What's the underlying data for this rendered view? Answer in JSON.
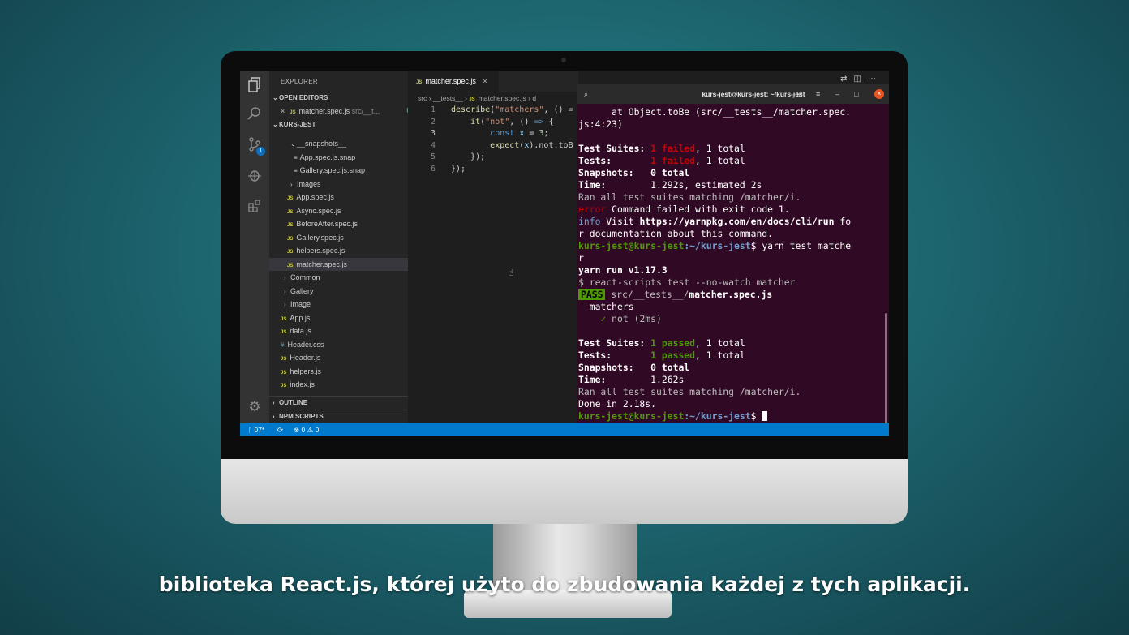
{
  "editor": {
    "explorer_title": "EXPLORER",
    "open_editors_label": "OPEN EDITORS",
    "open_editor_file": "matcher.spec.js",
    "open_editor_path": "src/__t...",
    "open_editor_flag": "U",
    "project_label": "KURS-JEST",
    "tree": [
      {
        "label": "__snapshots__",
        "kind": "folder-open"
      },
      {
        "label": "App.spec.js.snap",
        "kind": "snap"
      },
      {
        "label": "Gallery.spec.js.snap",
        "kind": "snap"
      },
      {
        "label": "Images",
        "kind": "folder"
      },
      {
        "label": "App.spec.js",
        "kind": "js"
      },
      {
        "label": "Async.spec.js",
        "kind": "js"
      },
      {
        "label": "BeforeAfter.spec.js",
        "kind": "js"
      },
      {
        "label": "Gallery.spec.js",
        "kind": "js"
      },
      {
        "label": "helpers.spec.js",
        "kind": "js"
      },
      {
        "label": "matcher.spec.js",
        "kind": "js",
        "flag": "U"
      },
      {
        "label": "Common",
        "kind": "folder"
      },
      {
        "label": "Gallery",
        "kind": "folder"
      },
      {
        "label": "Image",
        "kind": "folder"
      },
      {
        "label": "App.js",
        "kind": "js"
      },
      {
        "label": "data.js",
        "kind": "js"
      },
      {
        "label": "Header.css",
        "kind": "css"
      },
      {
        "label": "Header.js",
        "kind": "js"
      },
      {
        "label": "helpers.js",
        "kind": "js"
      },
      {
        "label": "index.js",
        "kind": "js"
      }
    ],
    "outline_label": "OUTLINE",
    "npm_scripts_label": "NPM SCRIPTS",
    "tab_label": "matcher.spec.js",
    "breadcrumb": [
      "src",
      "__tests__",
      "matcher.spec.js",
      "d"
    ],
    "line_numbers": [
      "1",
      "2",
      "3",
      "4",
      "5",
      "6"
    ],
    "code_lines": [
      "describe(\"matchers\", () =",
      "    it(\"not\", () => {",
      "        const x = 3;",
      "        expect(x).not.toB",
      "    });",
      "});"
    ],
    "status": {
      "branch": "07*",
      "errors": "0",
      "warnings": "0"
    }
  },
  "terminal": {
    "title": "kurs-jest@kurs-jest: ~/kurs-jest",
    "lines": {
      "l1": "      at Object.toBe (src/__tests__/matcher.spec.",
      "l2": "js:4:23)",
      "suites1_label": "Test Suites: ",
      "suites1_failed": "1 failed",
      "suites1_total": ", 1 total",
      "tests1_label": "Tests:       ",
      "tests1_failed": "1 failed",
      "tests1_total": ", 1 total",
      "snap1": "Snapshots:   0 total",
      "time1_label": "Time:        ",
      "time1_value": "1.292s, estimated 2s",
      "ran1": "Ran all test suites matching /matcher/i.",
      "error_word": "error",
      "error_msg": " Command failed with exit code 1.",
      "info_word": "info",
      "info_msg": " Visit ",
      "info_url": "https://yarnpkg.com/en/docs/cli/run",
      "info_tail": " fo",
      "info_l2": "r documentation about this command.",
      "prompt_user": "kurs-jest@kurs-jest",
      "prompt_path": ":~/kurs-jest",
      "prompt_cmd": "$ yarn test matche",
      "prompt_wrap": "r",
      "yarn_run": "yarn run v1.17.3",
      "scripts_cmd": "$ react-scripts test --no-watch matcher",
      "pass_badge": "PASS",
      "pass_path": " src/__tests__/",
      "pass_file": "matcher.spec.js",
      "describe_name": "  matchers",
      "check": "    ✓",
      "test_name": " not (2ms)",
      "suites2_label": "Test Suites: ",
      "suites2_passed": "1 passed",
      "suites2_total": ", 1 total",
      "tests2_label": "Tests:       ",
      "tests2_passed": "1 passed",
      "tests2_total": ", 1 total",
      "snap2": "Snapshots:   0 total",
      "time2_label": "Time:        ",
      "time2_value": "1.262s",
      "ran2": "Ran all test suites matching /matcher/i.",
      "done": "Done in 2.18s.",
      "final_prompt_dollar": "$ "
    }
  },
  "caption": "biblioteka React.js, której użyto do zbudowania każdej z tych aplikacji."
}
